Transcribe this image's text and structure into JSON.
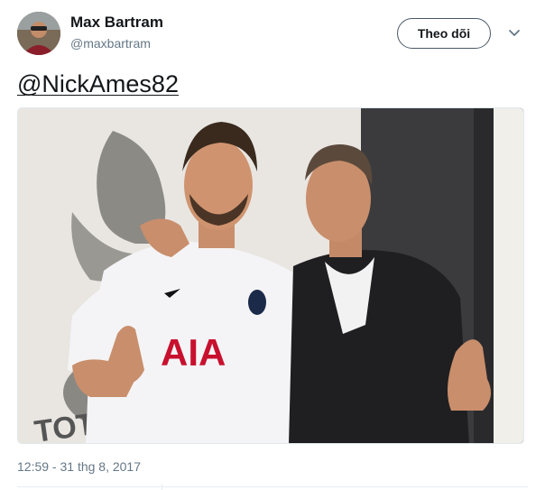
{
  "tweet": {
    "author_name": "Max Bartram",
    "author_handle": "@maxbartram",
    "follow_label": "Theo dõi",
    "mention_text": "@NickAmes82",
    "timestamp": "12:59 - 31 thg 8, 2017"
  },
  "photo": {
    "shirt_text": "AIA"
  },
  "icons": {
    "menu": "chevron-down-icon"
  },
  "colors": {
    "text_primary": "#14171a",
    "text_secondary": "#657786",
    "border": "#e1e8ed",
    "shirt_logo_red": "#c8102e"
  }
}
